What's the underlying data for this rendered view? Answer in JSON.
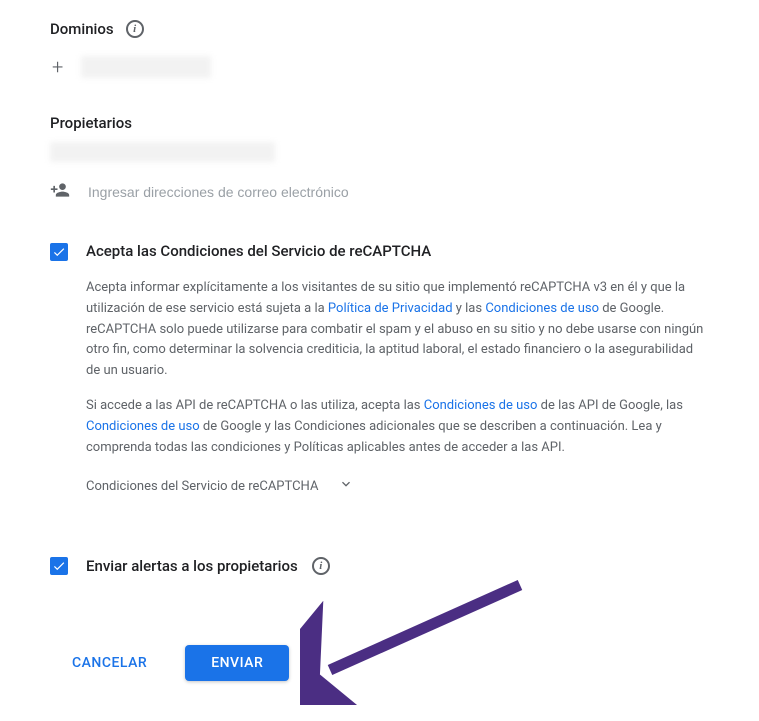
{
  "domains": {
    "title": "Dominios"
  },
  "owners": {
    "title": "Propietarios",
    "email_placeholder": "Ingresar direcciones de correo electrónico"
  },
  "terms": {
    "checkbox_label": "Acepta las Condiciones del Servicio de reCAPTCHA",
    "para1_part1": "Acepta informar explícitamente a los visitantes de su sitio que implementó reCAPTCHA v3 en él y que la utilización de ese servicio está sujeta a la ",
    "privacy_link": "Política de Privacidad",
    "para1_part2": " y las ",
    "tos_link1": "Condiciones de uso",
    "para1_part3": " de Google. reCAPTCHA solo puede utilizarse para combatir el spam y el abuso en su sitio y no debe usarse con ningún otro fin, como determinar la solvencia crediticia, la aptitud laboral, el estado financiero o la asegurabilidad de un usuario.",
    "para2_part1": "Si accede a las API de reCAPTCHA o las utiliza, acepta las ",
    "tos_link2": "Condiciones de uso",
    "para2_part2": " de las API de Google, las ",
    "tos_link3": "Condiciones de uso",
    "para2_part3": " de Google y las Condiciones adicionales que se describen a continuación. Lea y comprenda todas las condiciones y Políticas aplicables antes de acceder a las API.",
    "expand_label": "Condiciones del Servicio de reCAPTCHA"
  },
  "alerts": {
    "label": "Enviar alertas a los propietarios"
  },
  "buttons": {
    "cancel": "CANCELAR",
    "submit": "ENVIAR"
  }
}
